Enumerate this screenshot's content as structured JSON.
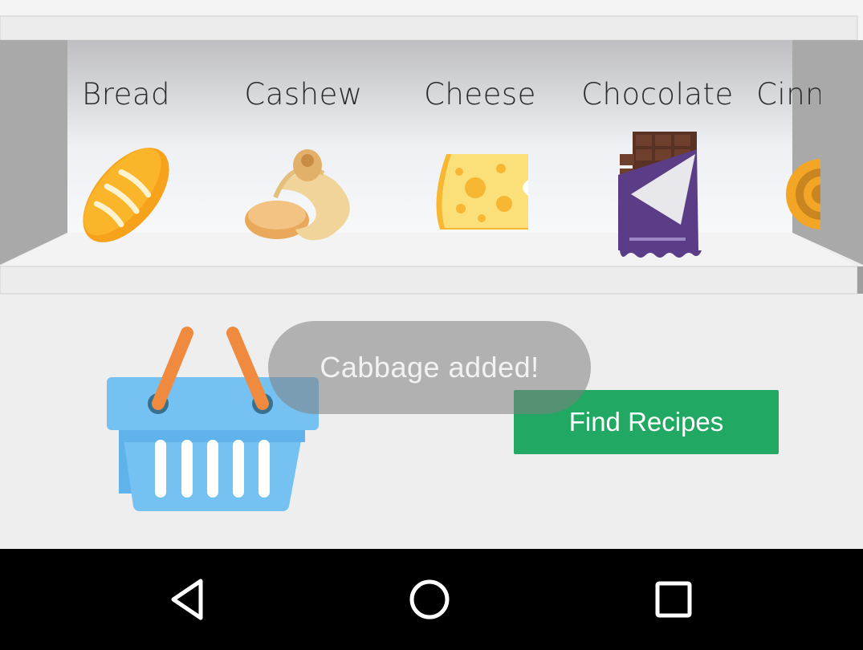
{
  "shelf": {
    "items": [
      {
        "label": "Bread",
        "icon": "bread-icon"
      },
      {
        "label": "Cashew",
        "icon": "cashew-icon"
      },
      {
        "label": "Cheese",
        "icon": "cheese-icon"
      },
      {
        "label": "Chocolate",
        "icon": "chocolate-icon"
      },
      {
        "label": "Cinnamon",
        "icon": "cinnamon-icon"
      }
    ]
  },
  "basket": {
    "icon": "basket-icon"
  },
  "toast": {
    "message": "Cabbage added!"
  },
  "actions": {
    "find_recipes_label": "Find Recipes"
  },
  "navbar": {
    "back": "back-icon",
    "home": "home-icon",
    "recents": "recents-icon"
  },
  "colors": {
    "accent_green": "#21a862",
    "basket_blue": "#74c1f2",
    "handle_orange": "#ef8a3e"
  }
}
